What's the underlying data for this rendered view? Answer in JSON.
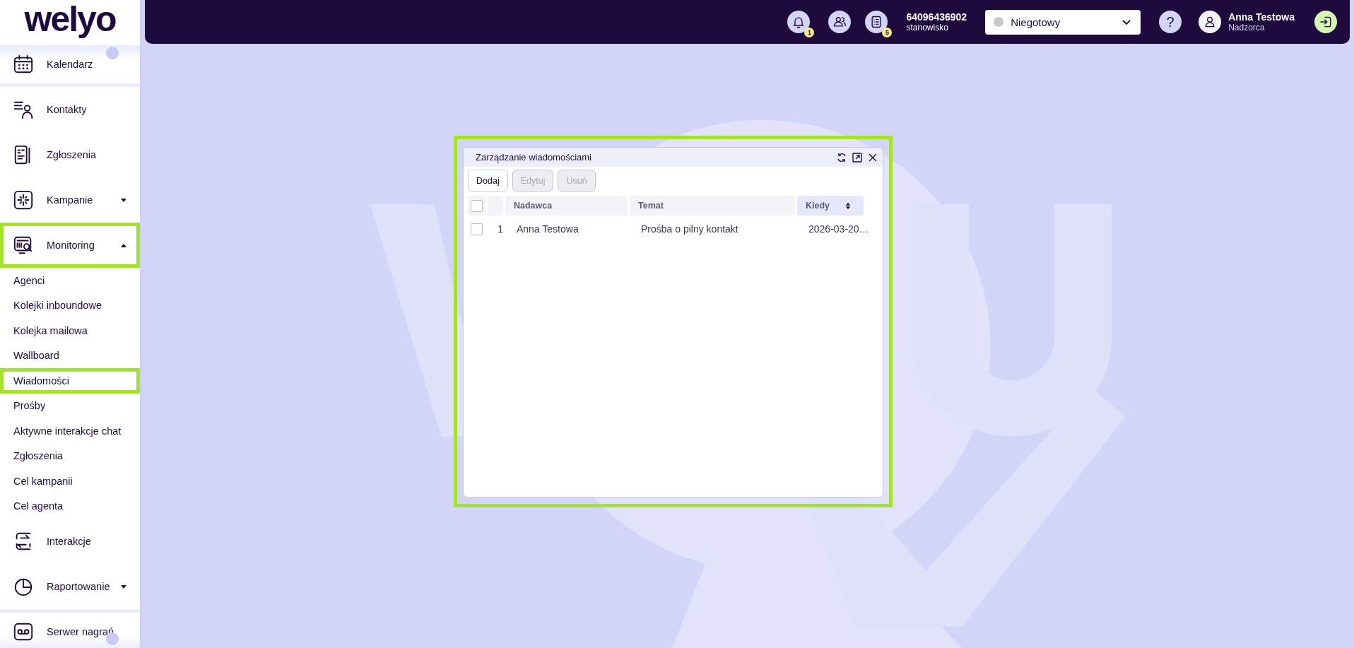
{
  "sidebar": {
    "logo": "welyo",
    "items": [
      {
        "label": "Kalendarz",
        "kind": "link",
        "highlighted": false
      },
      {
        "label": "Kontakty",
        "kind": "link",
        "highlighted": false
      },
      {
        "label": "Zgłoszenia",
        "kind": "link",
        "highlighted": false
      },
      {
        "label": "Kampanie",
        "kind": "group",
        "expanded": false,
        "highlighted": false
      },
      {
        "label": "Monitoring",
        "kind": "group",
        "expanded": true,
        "highlighted": true,
        "children": [
          {
            "label": "Agenci",
            "highlighted": false
          },
          {
            "label": "Kolejki inboundowe",
            "highlighted": false
          },
          {
            "label": "Kolejka mailowa",
            "highlighted": false
          },
          {
            "label": "Wallboard",
            "highlighted": false
          },
          {
            "label": "Wiadomości",
            "highlighted": true
          },
          {
            "label": "Prośby",
            "highlighted": false
          },
          {
            "label": "Aktywne interakcje chat",
            "highlighted": false
          },
          {
            "label": "Zgłoszenia",
            "highlighted": false
          },
          {
            "label": "Cel kampanii",
            "highlighted": false
          },
          {
            "label": "Cel agenta",
            "highlighted": false
          }
        ]
      },
      {
        "label": "Interakcje",
        "kind": "link",
        "highlighted": false
      },
      {
        "label": "Raportowanie",
        "kind": "group",
        "expanded": false,
        "highlighted": false
      },
      {
        "label": "Serwer nagrań",
        "kind": "link",
        "highlighted": false
      }
    ]
  },
  "header": {
    "notifications_badge": "1",
    "tasks_badge": "5",
    "station_number": "64096436902",
    "station_label": "stanowisko",
    "status": {
      "value": "Niegotowy",
      "color": "#c8c8c8"
    },
    "help": "?",
    "user": {
      "name": "Anna Testowa",
      "role": "Nadzorca"
    }
  },
  "dialog": {
    "title": "Zarządzanie wiadomościami",
    "highlighted": true,
    "buttons": [
      {
        "label": "Dodaj",
        "disabled": false
      },
      {
        "label": "Edytuj",
        "disabled": true
      },
      {
        "label": "Usuń",
        "disabled": true
      }
    ],
    "select_all": {
      "checked": false
    },
    "columns": [
      {
        "label": "Nadawca",
        "sortable": false
      },
      {
        "label": "Temat",
        "sortable": false
      },
      {
        "label": "Kiedy",
        "sortable": true
      }
    ],
    "rows": [
      {
        "index": "1",
        "checked": false,
        "cells": [
          "Anna Testowa",
          "Prośba o pilny kontakt",
          "2026-03-20…"
        ]
      }
    ]
  }
}
